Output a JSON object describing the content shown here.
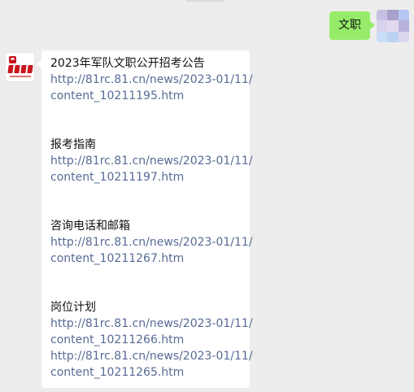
{
  "outgoing": {
    "text": "文职",
    "bubble_color": "#95ec69",
    "avatar_mosaic_colors": [
      "#c7c0e3",
      "#a9a1cc",
      "#b7c7f3",
      "#d8d3ec",
      "#e2d9ee",
      "#b9b2dc",
      "#c9def8",
      "#bcd2f2",
      "#dcd6ee"
    ]
  },
  "incoming": {
    "avatar_label": "account-logo",
    "brand_color": "#c8161d",
    "link_color": "#576b95",
    "sections": [
      {
        "title": "2023年军队文职公开招考公告",
        "links": [
          {
            "line1": "http://81rc.81.cn/news/2023-01/11/",
            "line2": "content_10211195.htm"
          }
        ]
      },
      {
        "title": "报考指南",
        "links": [
          {
            "line1": "http://81rc.81.cn/news/2023-01/11/",
            "line2": "content_10211197.htm"
          }
        ]
      },
      {
        "title": "咨询电话和邮箱",
        "links": [
          {
            "line1": "http://81rc.81.cn/news/2023-01/11/",
            "line2": "content_10211267.htm"
          }
        ]
      },
      {
        "title": "岗位计划",
        "links": [
          {
            "line1": "http://81rc.81.cn/news/2023-01/11/",
            "line2": "content_10211266.htm"
          },
          {
            "line1": "http://81rc.81.cn/news/2023-01/11/",
            "line2": "content_10211265.htm"
          }
        ]
      }
    ]
  }
}
